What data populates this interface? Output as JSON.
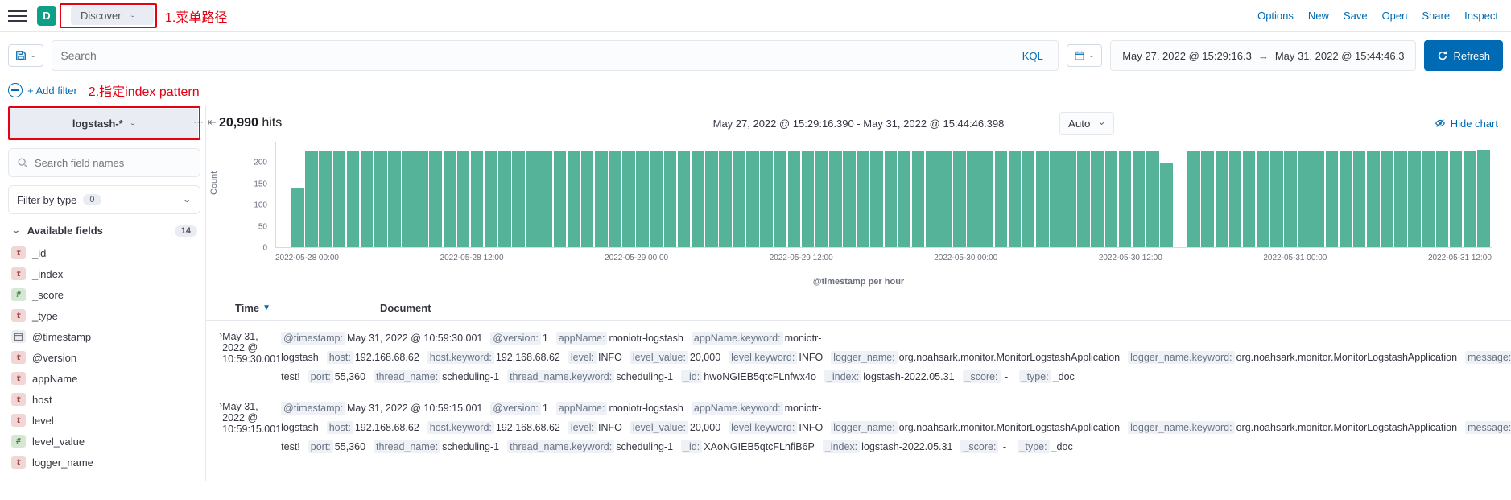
{
  "topbar": {
    "logo": "D",
    "page": "Discover"
  },
  "toplinks": {
    "options": "Options",
    "new": "New",
    "save": "Save",
    "open": "Open",
    "share": "Share",
    "inspect": "Inspect"
  },
  "annotations": {
    "a1": "1.菜单路径",
    "a2": "2.指定index pattern"
  },
  "query": {
    "placeholder": "Search",
    "lang": "KQL",
    "date_from": "May 27, 2022 @ 15:29:16.3",
    "date_to": "May 31, 2022 @ 15:44:46.3",
    "refresh": "Refresh",
    "addfilter": "+ Add filter"
  },
  "sidebar": {
    "pattern": "logstash-*",
    "search_placeholder": "Search field names",
    "filter_label": "Filter by type",
    "filter_count": "0",
    "available_label": "Available fields",
    "available_count": "14",
    "fields": [
      {
        "icon": "t",
        "name": "_id"
      },
      {
        "icon": "t",
        "name": "_index"
      },
      {
        "icon": "#",
        "name": "_score"
      },
      {
        "icon": "t",
        "name": "_type"
      },
      {
        "icon": "d",
        "name": "@timestamp"
      },
      {
        "icon": "t",
        "name": "@version"
      },
      {
        "icon": "t",
        "name": "appName"
      },
      {
        "icon": "t",
        "name": "host"
      },
      {
        "icon": "t",
        "name": "level"
      },
      {
        "icon": "#",
        "name": "level_value"
      },
      {
        "icon": "t",
        "name": "logger_name"
      }
    ]
  },
  "hits": {
    "count": "20,990",
    "label": "hits",
    "range": "May 27, 2022 @ 15:29:16.390 - May 31, 2022 @ 15:44:46.398",
    "interval": "Auto",
    "hide": "Hide chart"
  },
  "chart_data": {
    "type": "bar",
    "ylabel": "Count",
    "xlabel": "@timestamp per hour",
    "ylim": [
      0,
      250
    ],
    "yticks": [
      0,
      50,
      100,
      150,
      200
    ],
    "xticks": [
      "2022-05-28 00:00",
      "2022-05-28 12:00",
      "2022-05-29 00:00",
      "2022-05-29 12:00",
      "2022-05-30 00:00",
      "2022-05-30 12:00",
      "2022-05-31 00:00",
      "2022-05-31 12:00"
    ],
    "values": [
      0,
      140,
      228,
      228,
      228,
      228,
      228,
      228,
      228,
      228,
      228,
      228,
      228,
      228,
      228,
      228,
      228,
      228,
      228,
      228,
      228,
      228,
      228,
      228,
      228,
      228,
      228,
      228,
      228,
      228,
      228,
      228,
      228,
      228,
      228,
      228,
      228,
      228,
      228,
      228,
      228,
      228,
      228,
      228,
      228,
      228,
      228,
      228,
      228,
      228,
      228,
      228,
      228,
      228,
      228,
      228,
      228,
      228,
      228,
      228,
      228,
      228,
      228,
      228,
      200,
      0,
      228,
      228,
      228,
      228,
      228,
      228,
      228,
      228,
      228,
      228,
      228,
      228,
      228,
      228,
      228,
      228,
      228,
      228,
      228,
      228,
      228,
      230
    ]
  },
  "table": {
    "h_time": "Time",
    "h_doc": "Document",
    "rows": [
      {
        "time": "May 31, 2022 @ 10:59:30.001",
        "pairs": [
          {
            "k": "@timestamp:",
            "v": "May 31, 2022 @ 10:59:30.001"
          },
          {
            "k": "@version:",
            "v": "1"
          },
          {
            "k": "appName:",
            "v": "moniotr-logstash"
          },
          {
            "k": "appName.keyword:",
            "v": "moniotr-logstash"
          },
          {
            "k": "host:",
            "v": "192.168.68.62"
          },
          {
            "k": "host.keyword:",
            "v": "192.168.68.62"
          },
          {
            "k": "level:",
            "v": "INFO"
          },
          {
            "k": "level_value:",
            "v": "20,000"
          },
          {
            "k": "level.keyword:",
            "v": "INFO"
          },
          {
            "k": "logger_name:",
            "v": "org.noahsark.monitor.MonitorLogstashApplication"
          },
          {
            "k": "logger_name.keyword:",
            "v": "org.noahsark.monitor.MonitorLogstashApplication"
          },
          {
            "k": "message:",
            "v": "logstash test!"
          },
          {
            "k": "port:",
            "v": "55,360"
          },
          {
            "k": "thread_name:",
            "v": "scheduling-1"
          },
          {
            "k": "thread_name.keyword:",
            "v": "scheduling-1"
          },
          {
            "k": "_id:",
            "v": "hwoNGIEB5qtcFLnfwx4o"
          },
          {
            "k": "_index:",
            "v": "logstash-2022.05.31"
          },
          {
            "k": "_score:",
            "v": " - "
          },
          {
            "k": "_type:",
            "v": "_doc"
          }
        ]
      },
      {
        "time": "May 31, 2022 @ 10:59:15.001",
        "pairs": [
          {
            "k": "@timestamp:",
            "v": "May 31, 2022 @ 10:59:15.001"
          },
          {
            "k": "@version:",
            "v": "1"
          },
          {
            "k": "appName:",
            "v": "moniotr-logstash"
          },
          {
            "k": "appName.keyword:",
            "v": "moniotr-logstash"
          },
          {
            "k": "host:",
            "v": "192.168.68.62"
          },
          {
            "k": "host.keyword:",
            "v": "192.168.68.62"
          },
          {
            "k": "level:",
            "v": "INFO"
          },
          {
            "k": "level_value:",
            "v": "20,000"
          },
          {
            "k": "level.keyword:",
            "v": "INFO"
          },
          {
            "k": "logger_name:",
            "v": "org.noahsark.monitor.MonitorLogstashApplication"
          },
          {
            "k": "logger_name.keyword:",
            "v": "org.noahsark.monitor.MonitorLogstashApplication"
          },
          {
            "k": "message:",
            "v": "logstash test!"
          },
          {
            "k": "port:",
            "v": "55,360"
          },
          {
            "k": "thread_name:",
            "v": "scheduling-1"
          },
          {
            "k": "thread_name.keyword:",
            "v": "scheduling-1"
          },
          {
            "k": "_id:",
            "v": "XAoNGIEB5qtcFLnfiB6P"
          },
          {
            "k": "_index:",
            "v": "logstash-2022.05.31"
          },
          {
            "k": "_score:",
            "v": " - "
          },
          {
            "k": "_type:",
            "v": "_doc"
          }
        ]
      }
    ]
  }
}
